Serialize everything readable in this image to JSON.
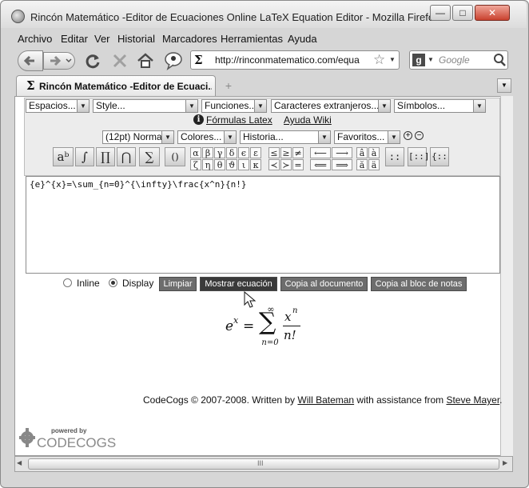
{
  "window": {
    "title": "Rincón Matemático -Editor de Ecuaciones Online LaTeX Equation Editor - Mozilla Firefox",
    "minimize": "—",
    "maximize": "□",
    "close": "✕"
  },
  "menu": [
    "Archivo",
    "Editar",
    "Ver",
    "Historial",
    "Marcadores",
    "Herramientas",
    "Ayuda"
  ],
  "nav": {
    "url": "http://rinconmatematico.com/equa",
    "search_placeholder": "Google"
  },
  "tab": {
    "label": "Rincón Matemático -Editor de Ecuaci...",
    "new_tab": "+"
  },
  "editor": {
    "selects_row1": [
      "Espacios...",
      "Style...",
      "Funciones...",
      "Caracteres extranjeros...",
      "Símbolos..."
    ],
    "links": [
      "Fórmulas Latex",
      "Ayuda Wiki"
    ],
    "selects_row2": [
      "(12pt) Normal",
      "Colores...",
      "Historia...",
      "Favoritos..."
    ],
    "latex_input": "{e}^{x}=\\sum_{n=0}^{\\infty}\\frac{x^n}{n!}",
    "symbol_groups": {
      "greek": [
        "α",
        "β",
        "γ",
        "δ",
        "ϵ",
        "ε",
        "ζ",
        "η",
        "θ",
        "ϑ",
        "ι",
        "κ"
      ],
      "relations": [
        "≤",
        "≥",
        "≠",
        "≺",
        "≻",
        "="
      ],
      "arrows": [
        "⟵",
        "⟶",
        "⟸",
        "⟹"
      ],
      "accents": [
        "â",
        "à",
        "ă",
        "ä"
      ],
      "matrices": [
        "::",
        "[::]",
        "{::"
      ]
    },
    "tool_buttons": [
      "aᵇ",
      "∫",
      "∏",
      "⋂",
      "∑",
      "()"
    ]
  },
  "controls": {
    "inline_label": "Inline",
    "display_label": "Display",
    "selected": "Display",
    "buttons": [
      "Limpiar",
      "Mostrar ecuación",
      "Copia al documento",
      "Copia al bloc de notas"
    ]
  },
  "rendered": {
    "lhs_base": "e",
    "lhs_exp": "x",
    "sum_upper": "∞",
    "sum_lower": "n=0",
    "numerator": "x",
    "num_exp": "n",
    "denominator": "n!"
  },
  "footer": {
    "prefix": "CodeCogs © 2007-2008. Written by ",
    "author": "Will Bateman",
    "middle": " with assistance from ",
    "assistant": "Steve Mayer",
    "suffix": "."
  },
  "logo": {
    "powered": "powered by",
    "name": "CODECOGS"
  },
  "status": {
    "scroll_grip": "III"
  }
}
